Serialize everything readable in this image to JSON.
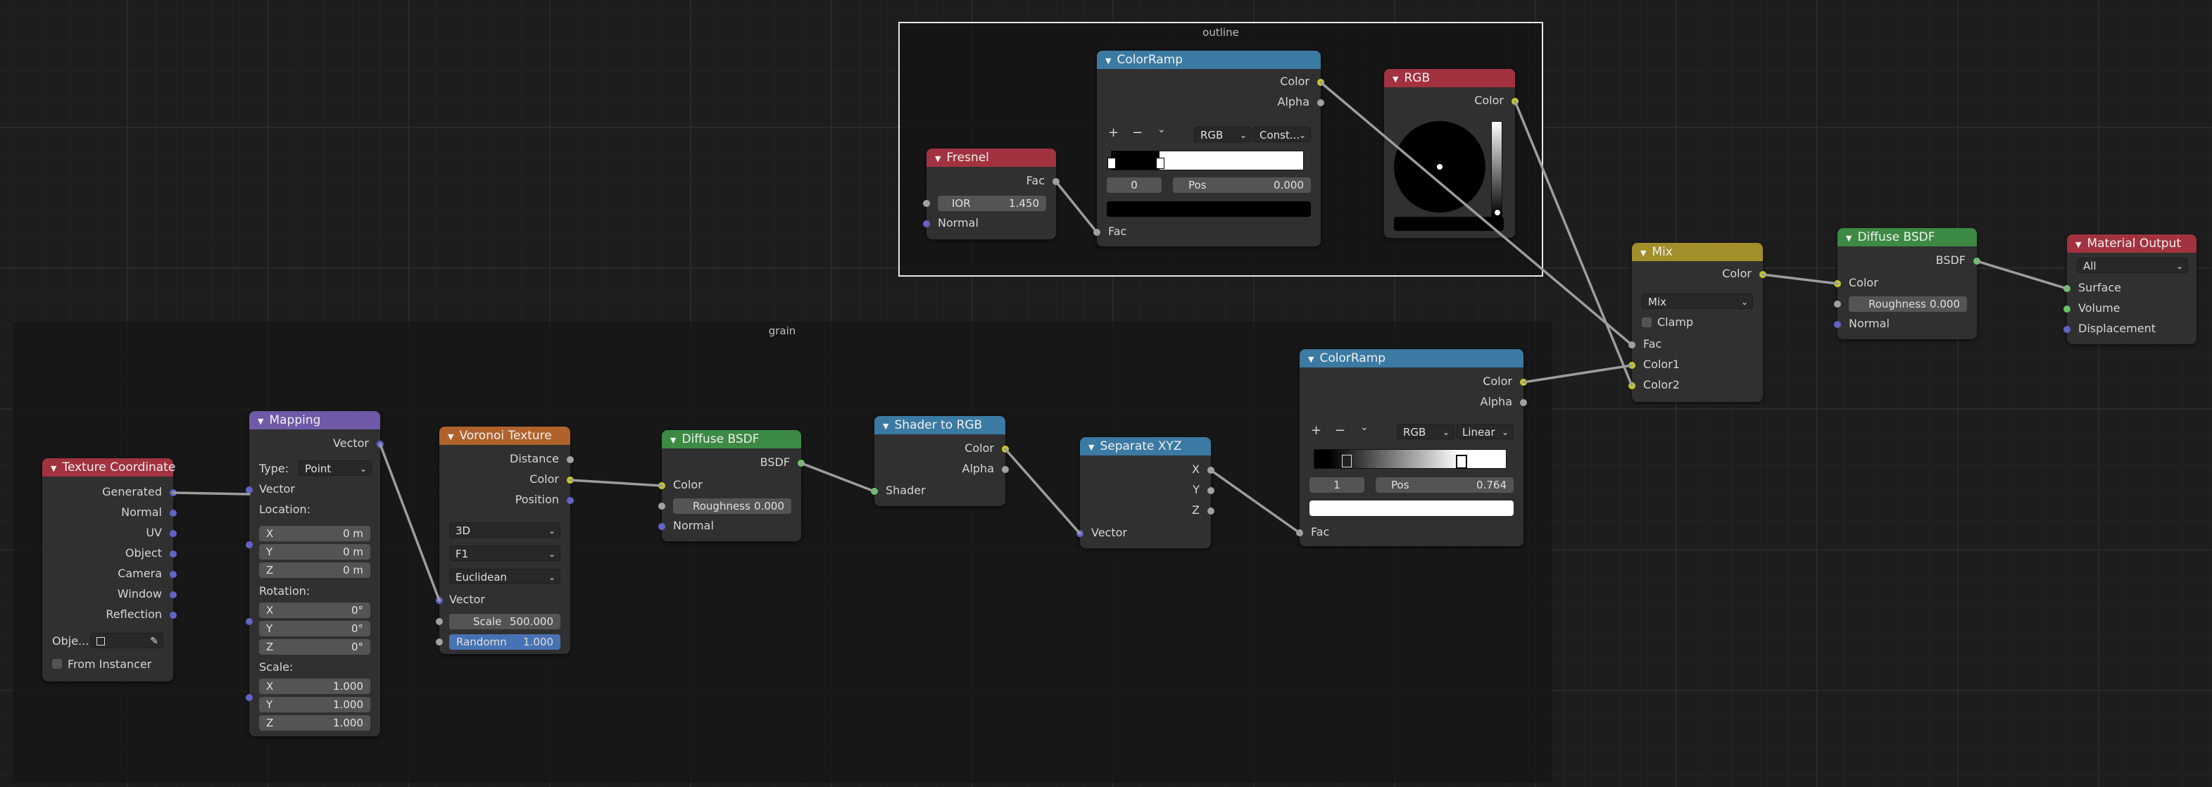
{
  "frames": {
    "outline": {
      "label": "outline"
    },
    "grain": {
      "label": "grain"
    }
  },
  "nodes": {
    "texcoord": {
      "title": "Texture Coordinate",
      "outputs": [
        "Generated",
        "Normal",
        "UV",
        "Object",
        "Camera",
        "Window",
        "Reflection"
      ],
      "object_label": "Obje...",
      "from_instancer": "From Instancer"
    },
    "mapping": {
      "title": "Mapping",
      "out_vector": "Vector",
      "type_label": "Type:",
      "type_value": "Point",
      "in_vector": "Vector",
      "location_label": "Location:",
      "location": [
        {
          "axis": "X",
          "value": "0 m"
        },
        {
          "axis": "Y",
          "value": "0 m"
        },
        {
          "axis": "Z",
          "value": "0 m"
        }
      ],
      "rotation_label": "Rotation:",
      "rotation": [
        {
          "axis": "X",
          "value": "0°"
        },
        {
          "axis": "Y",
          "value": "0°"
        },
        {
          "axis": "Z",
          "value": "0°"
        }
      ],
      "scale_label": "Scale:",
      "scale": [
        {
          "axis": "X",
          "value": "1.000"
        },
        {
          "axis": "Y",
          "value": "1.000"
        },
        {
          "axis": "Z",
          "value": "1.000"
        }
      ]
    },
    "voronoi": {
      "title": "Voronoi Texture",
      "outputs": [
        "Distance",
        "Color",
        "Position"
      ],
      "dim": "3D",
      "feature": "F1",
      "metric": "Euclidean",
      "in_vector": "Vector",
      "scale_label": "Scale",
      "scale_value": "500.000",
      "random_label": "Randomn",
      "random_value": "1.000"
    },
    "diffuse1": {
      "title": "Diffuse BSDF",
      "out": "BSDF",
      "color": "Color",
      "roughness_label": "Roughness",
      "roughness_value": "0.000",
      "normal": "Normal"
    },
    "shader2rgb": {
      "title": "Shader to RGB",
      "outputs": [
        "Color",
        "Alpha"
      ],
      "in": "Shader"
    },
    "sepxyz": {
      "title": "Separate XYZ",
      "outputs": [
        "X",
        "Y",
        "Z"
      ],
      "in": "Vector"
    },
    "ramp_grain": {
      "title": "ColorRamp",
      "outputs": [
        "Color",
        "Alpha"
      ],
      "mode": "RGB",
      "interp": "Linear",
      "index": "1",
      "pos_label": "Pos",
      "pos_value": "0.764",
      "in": "Fac"
    },
    "fresnel": {
      "title": "Fresnel",
      "out": "Fac",
      "ior_label": "IOR",
      "ior_value": "1.450",
      "normal": "Normal"
    },
    "ramp_outline": {
      "title": "ColorRamp",
      "outputs": [
        "Color",
        "Alpha"
      ],
      "mode": "RGB",
      "interp": "Const...",
      "index": "0",
      "pos_label": "Pos",
      "pos_value": "0.000",
      "in": "Fac"
    },
    "rgb": {
      "title": "RGB",
      "out": "Color"
    },
    "mix": {
      "title": "Mix",
      "out": "Color",
      "blend": "Mix",
      "clamp": "Clamp",
      "inputs": [
        "Fac",
        "Color1",
        "Color2"
      ]
    },
    "diffuse2": {
      "title": "Diffuse BSDF",
      "out": "BSDF",
      "color": "Color",
      "roughness_label": "Roughness",
      "roughness_value": "0.000",
      "normal": "Normal"
    },
    "output": {
      "title": "Material Output",
      "target": "All",
      "inputs": [
        "Surface",
        "Volume",
        "Displacement"
      ]
    }
  },
  "icons": {
    "collapse": "triangle-down",
    "add": "+",
    "remove": "−",
    "menu": "chevron-down",
    "eyedropper": "eyedropper"
  },
  "colors": {
    "color_socket": "#c7c729",
    "vector_socket": "#6363c7",
    "float_socket": "#a1a1a1",
    "shader_socket": "#63c763",
    "wire": "#a0a0a0"
  }
}
